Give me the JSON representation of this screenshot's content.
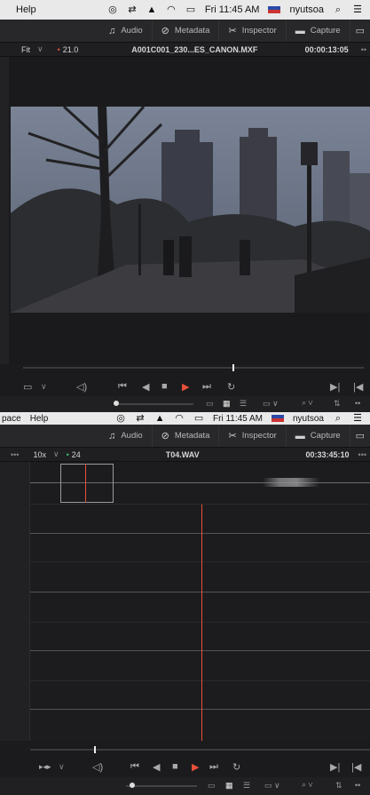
{
  "menubar_top": {
    "help": "Help",
    "clock": "Fri 11:45 AM",
    "user": "nyutsoa"
  },
  "toolbar_top": {
    "audio": "Audio",
    "metadata": "Metadata",
    "inspector": "Inspector",
    "capture": "Capture"
  },
  "viewer_top": {
    "zoom": "Fit",
    "chevron": "∨",
    "fps": "21.0",
    "clip_name": "A001C001_230...ES_CANON.MXF",
    "timecode": "00:00:13:05",
    "more": "••"
  },
  "menubar_bottom": {
    "space": "pace",
    "help": "Help",
    "clock": "Fri 11:45 AM",
    "user": "nyutsoa"
  },
  "toolbar_bottom": {
    "audio": "Audio",
    "metadata": "Metadata",
    "inspector": "Inspector",
    "capture": "Capture"
  },
  "viewer_bottom": {
    "more_left": "•••",
    "zoom": "10x",
    "chevron": "∨",
    "fps": "24",
    "clip_name": "T04.WAV",
    "timecode": "00:33:45:10",
    "more": "•••"
  },
  "colors": {
    "accent_red": "#e8503a",
    "panel": "#1b1b1d",
    "menubar": "#e9e9e9"
  }
}
